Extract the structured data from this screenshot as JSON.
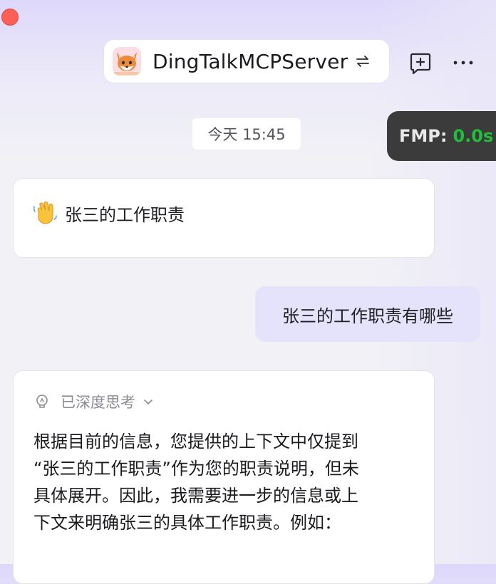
{
  "window": {
    "close_color": "#fe5f57"
  },
  "header": {
    "title": "DingTalkMCPServer",
    "avatar_icon": "fox-avatar-icon",
    "switch_icon": "switch-arrows-icon",
    "compose_icon": "new-chat-icon",
    "more_icon": "more-dots-icon"
  },
  "timestamp": {
    "label": "今天 15:45"
  },
  "fmp": {
    "label": "FMP:",
    "value": "0.0s",
    "value_color": "#1fbf3a"
  },
  "greeting": {
    "icon": "waving-hand-icon",
    "text": "张三的工作职责"
  },
  "user_message": {
    "text": "张三的工作职责有哪些"
  },
  "answer": {
    "thinking_icon": "lightbulb-icon",
    "thinking_label": "已深度思考",
    "expand_icon": "chevron-down-icon",
    "lines": [
      "根据目前的信息，您提供的上下文中仅提到",
      "“张三的工作职责”作为您的职责说明，但未",
      "具体展开。因此，我需要进一步的信息或上",
      "下文来明确张三的具体工作职责。例如："
    ]
  },
  "colors": {
    "accent_bubble": "#e4e3fb",
    "badge_bg": "#3b3b3b"
  }
}
